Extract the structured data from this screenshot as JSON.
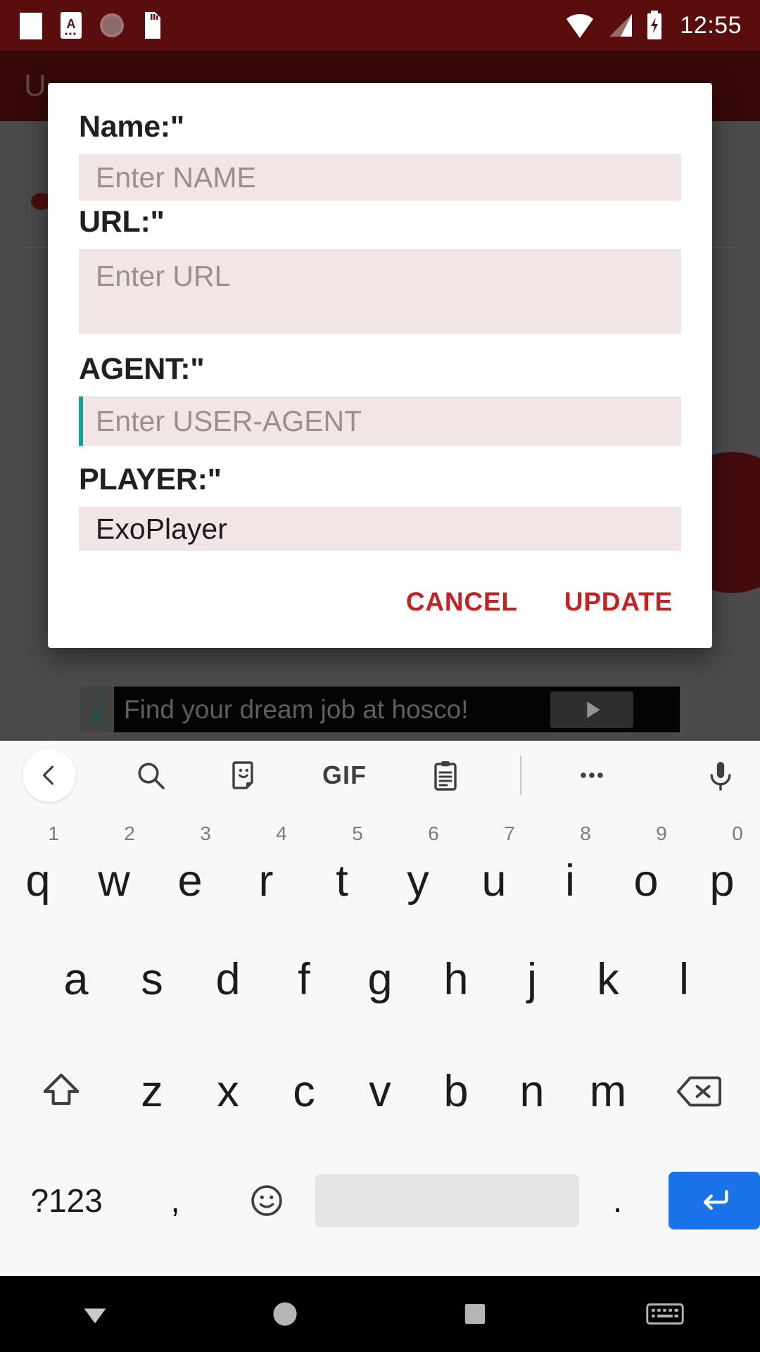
{
  "status_bar": {
    "icons": [
      "blank-notification-icon",
      "a-badge-icon",
      "circle-dotted-icon",
      "sd-card-icon"
    ],
    "wifi_icon": "wifi-icon",
    "signal_icon": "cell-signal-icon",
    "battery_icon": "battery-charging-icon",
    "time": "12:55",
    "background": "#5A0D0D"
  },
  "app": {
    "title": "U",
    "ad": {
      "info_glyph": "ⓘ",
      "close_glyph": "✕",
      "text": "Find your dream job at hosco!",
      "cta_icon": "play-arrow-icon"
    }
  },
  "dialog": {
    "fields": [
      {
        "label": "Name:\"",
        "placeholder": "Enter NAME",
        "value": "",
        "focused": false
      },
      {
        "label": "URL:\"",
        "placeholder": "Enter URL",
        "value": "",
        "focused": false
      },
      {
        "label": "AGENT:\"",
        "placeholder": "Enter USER-AGENT",
        "value": "",
        "focused": true
      },
      {
        "label": "PLAYER:\"",
        "placeholder": "",
        "value": "ExoPlayer",
        "focused": false
      }
    ],
    "cancel_label": "CANCEL",
    "update_label": "UPDATE",
    "accent_color": "#C42122",
    "field_background": "#F2E5E5",
    "caret_color": "#11A394"
  },
  "keyboard": {
    "toolbar": [
      {
        "name": "back-chevron-icon"
      },
      {
        "name": "search-icon"
      },
      {
        "name": "sticker-icon"
      },
      {
        "name": "gif-icon",
        "label": "GIF"
      },
      {
        "name": "clipboard-icon"
      },
      {
        "name": "more-options-icon"
      },
      {
        "name": "microphone-icon"
      }
    ],
    "row1": [
      {
        "letter": "q",
        "num": "1"
      },
      {
        "letter": "w",
        "num": "2"
      },
      {
        "letter": "e",
        "num": "3"
      },
      {
        "letter": "r",
        "num": "4"
      },
      {
        "letter": "t",
        "num": "5"
      },
      {
        "letter": "y",
        "num": "6"
      },
      {
        "letter": "u",
        "num": "7"
      },
      {
        "letter": "i",
        "num": "8"
      },
      {
        "letter": "o",
        "num": "9"
      },
      {
        "letter": "p",
        "num": "0"
      }
    ],
    "row2": [
      {
        "letter": "a"
      },
      {
        "letter": "s"
      },
      {
        "letter": "d"
      },
      {
        "letter": "f"
      },
      {
        "letter": "g"
      },
      {
        "letter": "h"
      },
      {
        "letter": "j"
      },
      {
        "letter": "k"
      },
      {
        "letter": "l"
      }
    ],
    "row3": [
      {
        "letter": "z"
      },
      {
        "letter": "x"
      },
      {
        "letter": "c"
      },
      {
        "letter": "v"
      },
      {
        "letter": "b"
      },
      {
        "letter": "n"
      },
      {
        "letter": "m"
      }
    ],
    "shift_icon": "shift-icon",
    "backspace_icon": "backspace-icon",
    "symbols_label": "?123",
    "comma_label": ",",
    "emoji_icon": "emoji-icon",
    "space_label": "",
    "period_label": ".",
    "enter_icon": "enter-icon",
    "enter_color": "#1A73E8"
  },
  "nav_bar": {
    "back_icon": "nav-back-icon",
    "home_icon": "nav-home-icon",
    "recents_icon": "nav-recents-icon",
    "keyboard_icon": "nav-keyboard-icon"
  }
}
